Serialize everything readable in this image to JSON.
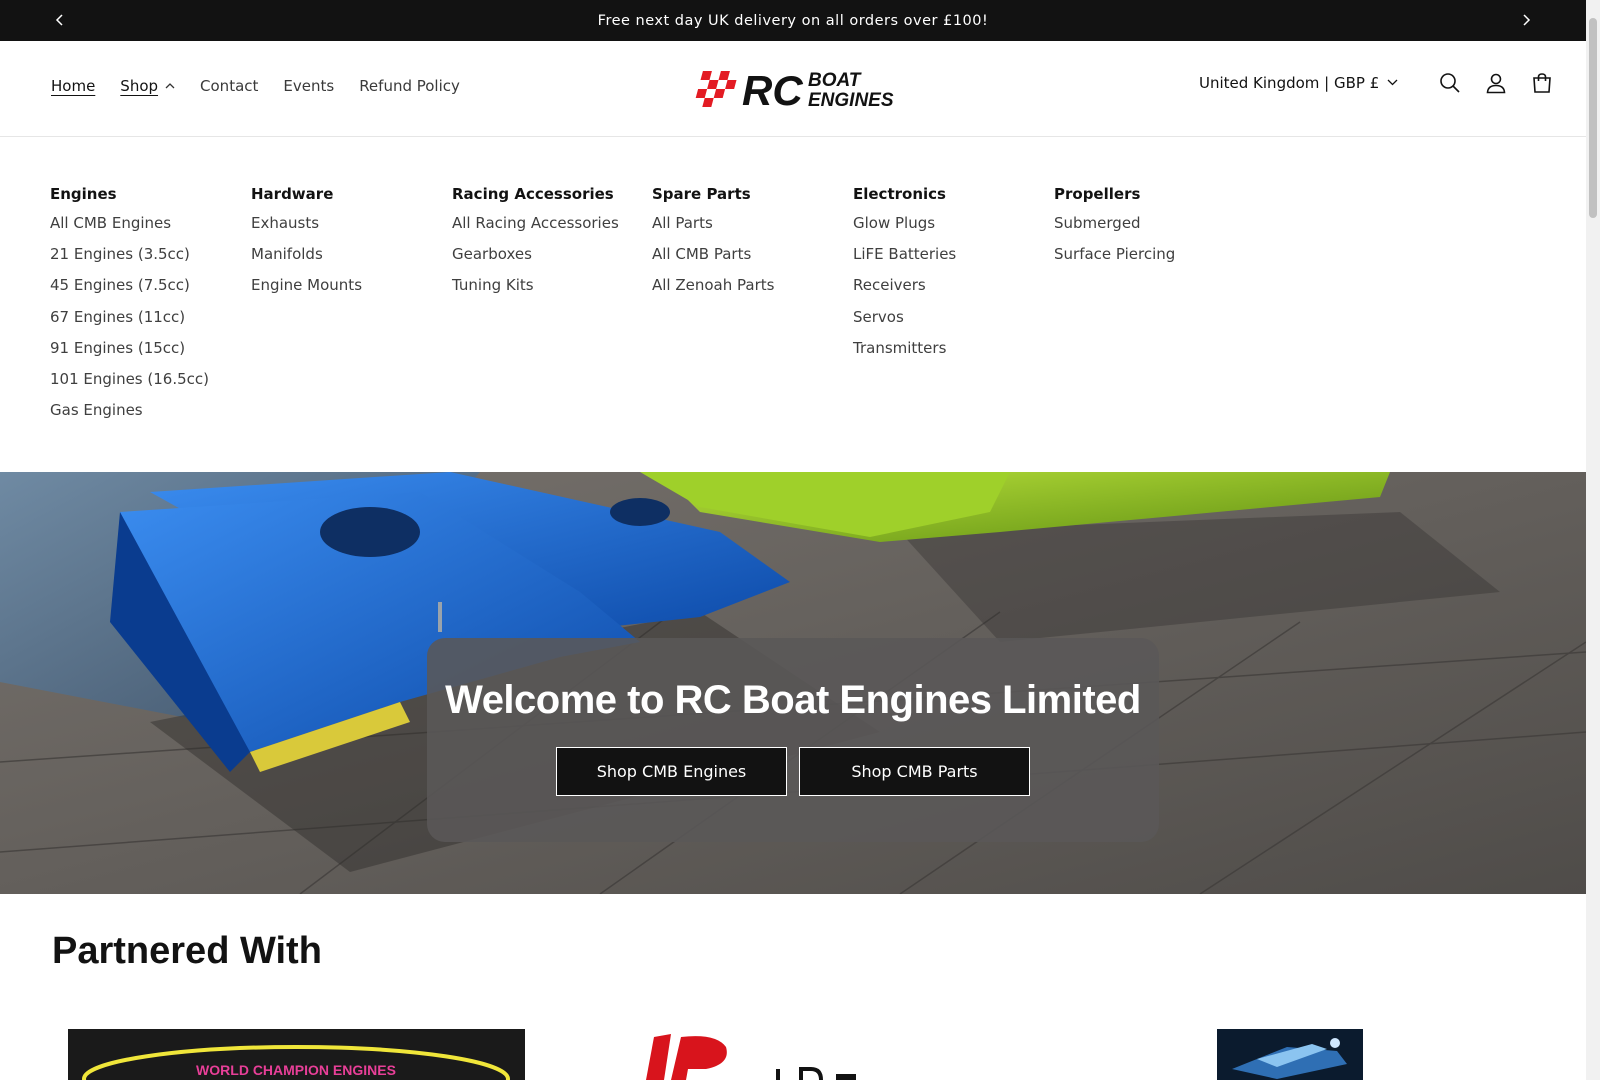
{
  "announcement": {
    "text": "Free next day UK delivery on all orders over £100!",
    "prev_icon": "chevron-left-icon",
    "next_icon": "chevron-right-icon"
  },
  "nav": {
    "home": "Home",
    "shop": "Shop",
    "contact": "Contact",
    "events": "Events",
    "refund": "Refund Policy"
  },
  "logo": {
    "line1": "RC",
    "line2": "BOAT",
    "line3": "ENGINES"
  },
  "header": {
    "country": "United Kingdom | GBP £",
    "icons": [
      "search-icon",
      "account-icon",
      "cart-icon"
    ]
  },
  "menu": {
    "columns": [
      {
        "heading": "Engines",
        "items": [
          "All CMB Engines",
          "21 Engines (3.5cc)",
          "45 Engines (7.5cc)",
          "67 Engines (11cc)",
          "91 Engines (15cc)",
          "101 Engines (16.5cc)",
          "Gas Engines"
        ]
      },
      {
        "heading": "Hardware",
        "items": [
          "Exhausts",
          "Manifolds",
          "Engine Mounts"
        ]
      },
      {
        "heading": "Racing Accessories",
        "items": [
          "All Racing Accessories",
          "Gearboxes",
          "Tuning Kits"
        ]
      },
      {
        "heading": "Spare Parts",
        "items": [
          "All Parts",
          "All CMB Parts",
          "All Zenoah Parts"
        ]
      },
      {
        "heading": "Electronics",
        "items": [
          "Glow Plugs",
          "LiFE Batteries",
          "Receivers",
          "Servos",
          "Transmitters"
        ]
      },
      {
        "heading": "Propellers",
        "items": [
          "Submerged",
          "Surface Piercing"
        ]
      }
    ]
  },
  "hero": {
    "title": "Welcome to RC Boat Engines Limited",
    "button1": "Shop CMB Engines",
    "button2": "Shop CMB Parts"
  },
  "partners": {
    "title": "Partnered With",
    "logo1_text": "WORLD CHAMPION ENGINES"
  },
  "colors": {
    "brand_red": "#e31b23",
    "dark": "#121212",
    "boat_blue": "#1a63c8",
    "boat_green": "#8bbf22"
  }
}
